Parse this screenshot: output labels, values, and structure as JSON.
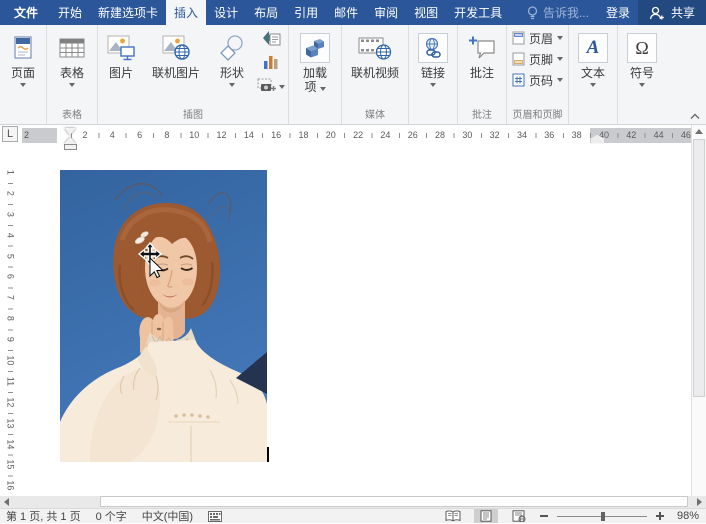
{
  "titlebar": {
    "tabs": [
      {
        "label": "文件"
      },
      {
        "label": "开始"
      },
      {
        "label": "新建选项卡"
      },
      {
        "label": "插入"
      },
      {
        "label": "设计"
      },
      {
        "label": "布局"
      },
      {
        "label": "引用"
      },
      {
        "label": "邮件"
      },
      {
        "label": "审阅"
      },
      {
        "label": "视图"
      },
      {
        "label": "开发工具"
      }
    ],
    "tell_me": "告诉我...",
    "sign_in": "登录",
    "share": "共享"
  },
  "ribbon": {
    "buttons": {
      "pages": "页面",
      "tables": "表格",
      "picture": "图片",
      "online_picture": "联机图片",
      "shapes": "形状",
      "addins_line1": "加载",
      "addins_line2": "项",
      "online_video": "联机视频",
      "link": "链接",
      "comment": "批注",
      "header": "页眉",
      "footer": "页脚",
      "page_number": "页码",
      "text": "文本",
      "symbol": "符号"
    },
    "group_labels": {
      "tables": "表格",
      "illustrations": "插图",
      "media": "媒体",
      "comments": "批注",
      "header_footer": "页眉和页脚"
    },
    "glyphs": {
      "text_icon": "A",
      "symbol_icon": "Ω"
    }
  },
  "ruler": {
    "tab_selector": "L",
    "left_margin_number": "2",
    "numbers": [
      "2",
      "4",
      "6",
      "8",
      "10",
      "12",
      "14",
      "16",
      "18",
      "20",
      "22",
      "24",
      "26",
      "28",
      "30",
      "32",
      "34",
      "36",
      "38"
    ],
    "right_numbers": [
      "40",
      "42",
      "44",
      "46"
    ],
    "vertical_numbers": [
      "1",
      "2",
      "3",
      "4",
      "5",
      "6",
      "7",
      "8",
      "9",
      "10",
      "11",
      "12",
      "13",
      "14",
      "15",
      "16"
    ]
  },
  "statusbar": {
    "page_info": "第 1 页, 共 1 页",
    "word_count": "0 个字",
    "language": "中文(中国)",
    "zoom_level": "98%"
  },
  "colors": {
    "accent": "#2b579a",
    "sky": "#3a6fb0"
  }
}
